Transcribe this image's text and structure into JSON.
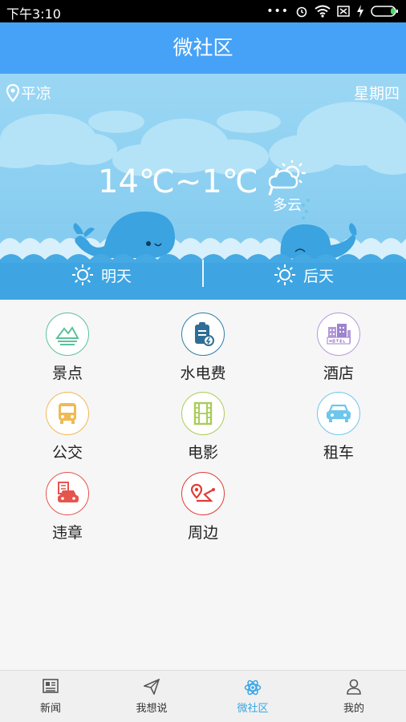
{
  "status_bar": {
    "time": "下午3:10",
    "icons": [
      "more-icon",
      "alarm-icon",
      "wifi-icon",
      "sim-off-icon",
      "charging-icon",
      "battery-icon"
    ]
  },
  "header": {
    "title": "微社区"
  },
  "weather": {
    "location": "平凉",
    "weekday": "星期四",
    "temperature": "14℃~1℃ /",
    "condition": "多云",
    "forecast": [
      {
        "label": "明天",
        "icon": "sun-icon"
      },
      {
        "label": "后天",
        "icon": "sun-icon"
      }
    ]
  },
  "services": [
    {
      "label": "景点",
      "icon": "mountain-icon",
      "color": "#5cc29a"
    },
    {
      "label": "水电费",
      "icon": "bill-icon",
      "color": "#2e7fa6"
    },
    {
      "label": "酒店",
      "icon": "hotel-icon",
      "color": "#b49ad9"
    },
    {
      "label": "公交",
      "icon": "bus-icon",
      "color": "#f0b954"
    },
    {
      "label": "电影",
      "icon": "film-icon",
      "color": "#a9cc58"
    },
    {
      "label": "租车",
      "icon": "car-icon",
      "color": "#6ec6ec"
    },
    {
      "label": "违章",
      "icon": "violation-icon",
      "color": "#e6544e"
    },
    {
      "label": "周边",
      "icon": "location-route-icon",
      "color": "#e23b36"
    }
  ],
  "nav": {
    "active": "微社区",
    "items": [
      {
        "label": "新闻",
        "icon": "newspaper-icon"
      },
      {
        "label": "我想说",
        "icon": "paper-plane-icon"
      },
      {
        "label": "微社区",
        "icon": "atom-icon"
      },
      {
        "label": "我的",
        "icon": "user-icon"
      }
    ],
    "active_color": "#37a6e6"
  }
}
